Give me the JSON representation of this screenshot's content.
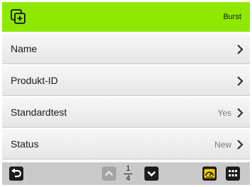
{
  "header": {
    "mode": "Burst",
    "app_icon": "copy-plus-icon",
    "accent_color": "#8ee800"
  },
  "menu": {
    "items": [
      {
        "label": "Name",
        "value": ""
      },
      {
        "label": "Produkt-ID",
        "value": ""
      },
      {
        "label": "Standardtest",
        "value": "Yes"
      },
      {
        "label": "Status",
        "value": "New"
      }
    ]
  },
  "footer": {
    "page": {
      "current": "1",
      "total": "4"
    },
    "icons": {
      "back": "back-arrow-icon",
      "page_up": "chevron-up-icon",
      "page_down": "chevron-down-icon",
      "gauge": "gauge-icon",
      "grid": "grid-menu-icon"
    }
  }
}
